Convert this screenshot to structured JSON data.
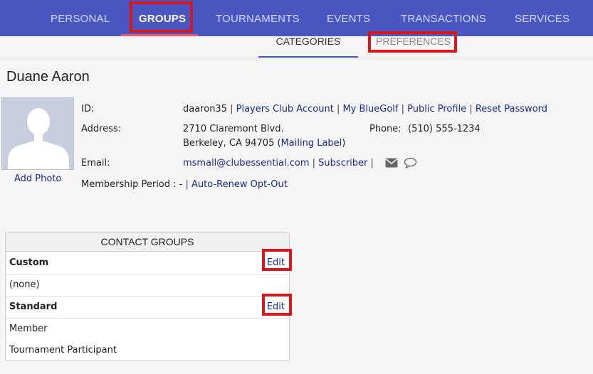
{
  "nav": {
    "tabs": [
      "PERSONAL",
      "GROUPS",
      "TOURNAMENTS",
      "EVENTS",
      "TRANSACTIONS",
      "SERVICES"
    ]
  },
  "subnav": {
    "tabs": [
      "CATEGORIES",
      "PREFERENCES"
    ]
  },
  "profile": {
    "name": "Duane Aaron",
    "add_photo": "Add Photo",
    "id_label": "ID:",
    "id_value": "daaron35",
    "id_links": [
      "Players Club Account",
      "My BlueGolf",
      "Public Profile",
      "Reset Password"
    ],
    "address_label": "Address:",
    "address_line1": "2710 Claremont Blvd.",
    "address_line2": "Berkeley, CA 94705",
    "mailing_label": "Mailing Label",
    "phone_label": "Phone:",
    "phone_value": "(510) 555-1234",
    "email_label": "Email:",
    "email_value": "msmall@clubessential.com",
    "subscriber": "Subscriber",
    "membership_label": "Membership Period :",
    "membership_value": "-",
    "auto_renew": "Auto-Renew Opt-Out"
  },
  "contact_groups": {
    "title": "CONTACT GROUPS",
    "sections": [
      {
        "name": "Custom",
        "edit": "Edit",
        "items": [
          "(none)"
        ]
      },
      {
        "name": "Standard",
        "edit": "Edit",
        "items": [
          "Member",
          "Tournament Participant"
        ]
      }
    ]
  },
  "icons": {
    "mail": "envelope-icon",
    "chat": "speech-bubble-icon",
    "avatar": "person-silhouette"
  },
  "colors": {
    "nav_bg": "#4a56c2",
    "highlight": "#d8161b",
    "link": "#1a2a8a"
  }
}
